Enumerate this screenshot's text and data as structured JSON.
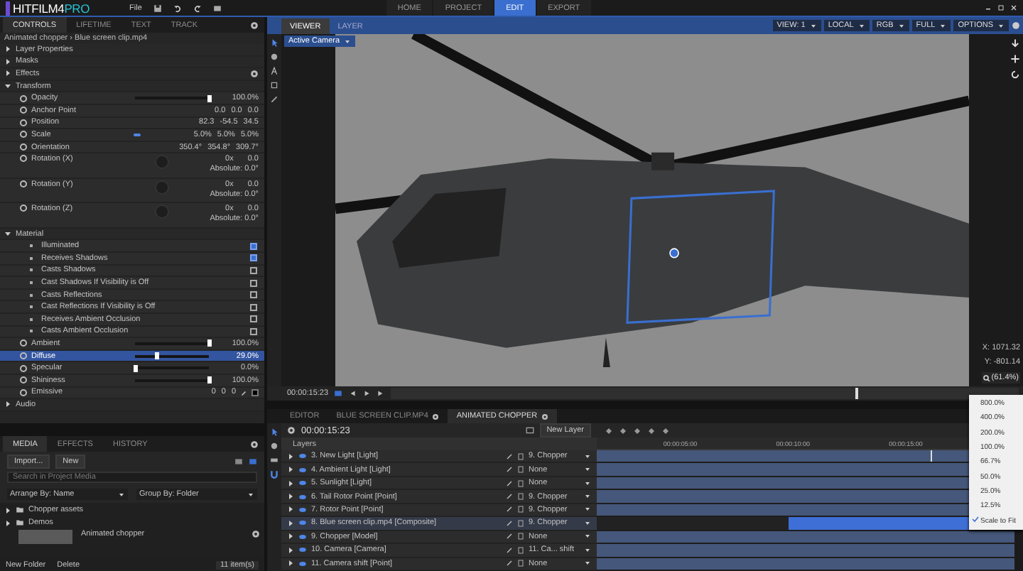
{
  "top_bar": {
    "logo": "HITFILM4",
    "logo_suffix": "PRO",
    "menu": [
      "File"
    ],
    "workspaces": [
      {
        "label": "HOME",
        "selected": false
      },
      {
        "label": "PROJECT",
        "selected": false
      },
      {
        "label": "EDIT",
        "selected": true
      },
      {
        "label": "EXPORT",
        "selected": false
      }
    ]
  },
  "controls": {
    "tabs": [
      {
        "label": "CONTROLS",
        "selected": true
      },
      {
        "label": "LIFETIME",
        "selected": false
      },
      {
        "label": "TEXT",
        "selected": false
      },
      {
        "label": "TRACK",
        "selected": false
      }
    ],
    "breadcrumb": "Animated chopper › Blue screen clip.mp4",
    "rows": [
      {
        "kind": "group",
        "label": "Layer Properties",
        "expanded": false
      },
      {
        "kind": "group",
        "label": "Masks",
        "expanded": false
      },
      {
        "kind": "group",
        "label": "Effects",
        "expanded": false
      },
      {
        "kind": "group",
        "label": "Transform",
        "expanded": true
      },
      {
        "kind": "slider",
        "label": "Opacity",
        "level": 1,
        "reading": "100.0%",
        "selected": false
      },
      {
        "kind": "values",
        "label": "Anchor Point",
        "values": [
          "0.0",
          "0.0",
          "0.0"
        ],
        "linked": false
      },
      {
        "kind": "values",
        "label": "Position",
        "values": [
          "82.3",
          "-54.5",
          "34.5"
        ],
        "linked": false
      },
      {
        "kind": "values",
        "label": "Scale",
        "values": [
          "5.0%",
          "5.0%",
          "5.0%"
        ],
        "linked": true
      },
      {
        "kind": "values",
        "label": "Orientation",
        "values": [
          "350.4°",
          "354.8°",
          "309.7°"
        ],
        "linked": false
      },
      {
        "kind": "rotation",
        "label": "Rotation (X)",
        "turns": "0x",
        "angle": "0.0",
        "absolute": "Absolute: 0.0°"
      },
      {
        "kind": "rotation",
        "label": "Rotation (Y)",
        "turns": "0x",
        "angle": "0.0",
        "absolute": "Absolute: 0.0°"
      },
      {
        "kind": "rotation",
        "label": "Rotation (Z)",
        "turns": "0x",
        "angle": "0.0",
        "absolute": "Absolute: 0.0°"
      },
      {
        "kind": "group",
        "label": "Material",
        "expanded": true
      },
      {
        "kind": "check",
        "label": "Illuminated",
        "checked": true
      },
      {
        "kind": "check",
        "label": "Receives Shadows",
        "checked": true
      },
      {
        "kind": "check",
        "label": "Casts Shadows",
        "checked": false
      },
      {
        "kind": "check",
        "label": "Cast Shadows If Visibility is Off",
        "checked": false
      },
      {
        "kind": "check",
        "label": "Casts Reflections",
        "checked": false
      },
      {
        "kind": "check",
        "label": "Cast Reflections If Visibility is Off",
        "checked": false
      },
      {
        "kind": "check",
        "label": "Receives Ambient Occlusion",
        "checked": false
      },
      {
        "kind": "check",
        "label": "Casts Ambient Occlusion",
        "checked": false
      },
      {
        "kind": "slider",
        "label": "Ambient",
        "level": 1,
        "reading": "100.0%",
        "selected": false
      },
      {
        "kind": "slider",
        "label": "Diffuse",
        "level": 0.29,
        "reading": "29.0%",
        "selected": true
      },
      {
        "kind": "slider",
        "label": "Specular",
        "level": 0,
        "reading": "0.0%",
        "selected": false
      },
      {
        "kind": "slider",
        "label": "Shininess",
        "level": 1,
        "reading": "100.0%",
        "selected": false
      },
      {
        "kind": "color",
        "label": "Emissive",
        "values": [
          "0",
          "0",
          "0"
        ]
      },
      {
        "kind": "group",
        "label": "Audio",
        "expanded": false
      }
    ]
  },
  "media": {
    "tabs": [
      {
        "label": "MEDIA",
        "selected": true
      },
      {
        "label": "EFFECTS",
        "selected": false
      },
      {
        "label": "HISTORY",
        "selected": false
      }
    ],
    "import_button": "Import...",
    "new_button": "New",
    "search": {
      "placeholder": "Search in Project Media"
    },
    "arrange": "Arrange By: Name",
    "group": "Group By: Folder",
    "items": [
      {
        "kind": "folder",
        "label": "Chopper assets"
      },
      {
        "kind": "folder",
        "label": "Demos"
      },
      {
        "kind": "clip",
        "label": "Animated chopper"
      }
    ],
    "new_folder": "New Folder",
    "delete": "Delete",
    "count": "11 item(s)"
  },
  "viewer": {
    "tabs": [
      {
        "label": "VIEWER",
        "selected": true
      },
      {
        "label": "LAYER",
        "selected": false
      }
    ],
    "options": [
      "VIEW: 1",
      "LOCAL",
      "RGB",
      "FULL",
      "OPTIONS"
    ],
    "camera": "Active Camera",
    "x_readout": "X: 1071.32",
    "y_readout": "Y: -801.14",
    "zoom": "(61.4%)",
    "timecode": "00:00:15:23"
  },
  "zoom_menu": [
    {
      "label": "800.0%",
      "checked": false
    },
    {
      "label": "400.0%",
      "checked": false
    },
    {
      "label": "200.0%",
      "checked": false
    },
    {
      "label": "100.0%",
      "checked": false
    },
    {
      "label": "66.7%",
      "checked": false
    },
    {
      "label": "50.0%",
      "checked": false
    },
    {
      "label": "25.0%",
      "checked": false
    },
    {
      "label": "12.5%",
      "checked": false
    },
    {
      "label": "Scale to Fit",
      "checked": true
    }
  ],
  "timeline": {
    "tabs": [
      {
        "label": "EDITOR",
        "selected": false,
        "settings": false
      },
      {
        "label": "BLUE SCREEN CLIP.MP4",
        "selected": false,
        "settings": true
      },
      {
        "label": "ANIMATED CHOPPER",
        "selected": true,
        "settings": true
      }
    ],
    "timecode": "00:00:15:23",
    "new_layer": "New Layer",
    "layers_heading": "Layers",
    "ruler": [
      "00:00:05:00",
      "00:00:10:00",
      "00:00:15:00"
    ],
    "layers": [
      {
        "name": "3. New Light [Light]",
        "parent": "9. Chopper",
        "selected": false
      },
      {
        "name": "4. Ambient Light [Light]",
        "parent": "None",
        "selected": false
      },
      {
        "name": "5. Sunlight [Light]",
        "parent": "None",
        "selected": false
      },
      {
        "name": "6. Tail Rotor Point [Point]",
        "parent": "9. Chopper",
        "selected": false
      },
      {
        "name": "7. Rotor Point [Point]",
        "parent": "9. Chopper",
        "selected": false
      },
      {
        "name": "8. Blue screen clip.mp4 [Composite]",
        "parent": "9. Chopper",
        "selected": true
      },
      {
        "name": "9. Chopper [Model]",
        "parent": "None",
        "selected": false
      },
      {
        "name": "10. Camera [Camera]",
        "parent": "11. Ca... shift",
        "selected": false
      },
      {
        "name": "11. Camera shift [Point]",
        "parent": "None",
        "selected": false
      }
    ]
  }
}
